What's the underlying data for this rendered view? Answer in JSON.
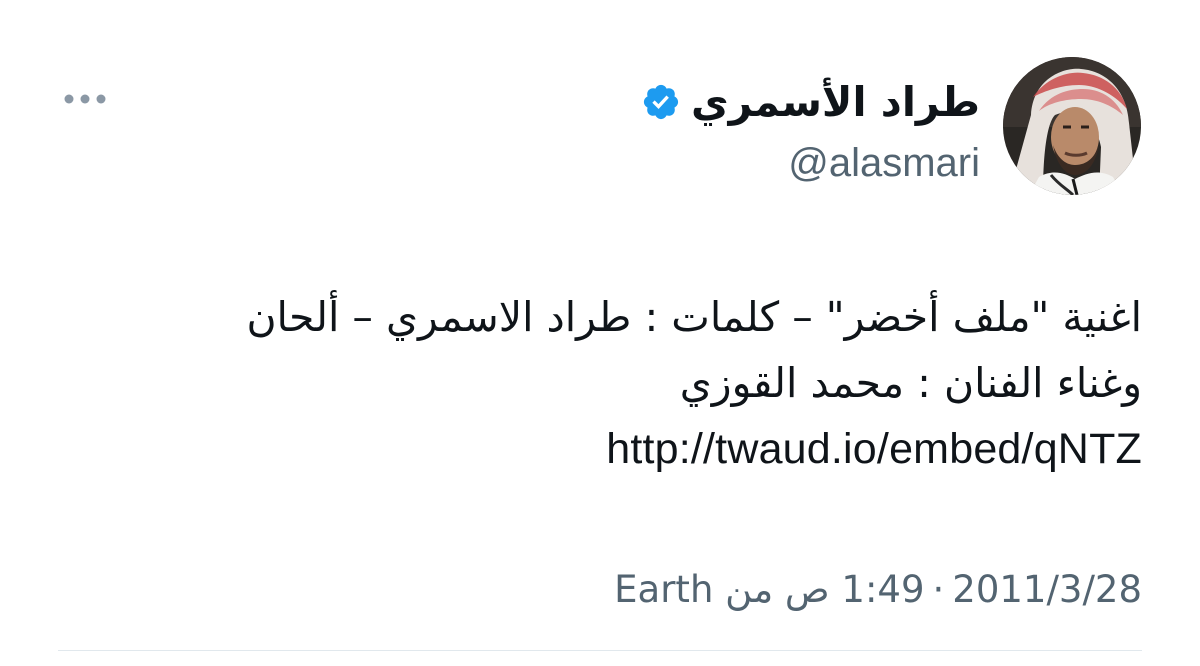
{
  "author": {
    "display_name": "طراد الأسمري",
    "handle": "@alasmari",
    "verified_color": "#1d9bf0"
  },
  "tweet": {
    "lines": [
      "اغنية \"ملف أخضر\" – كلمات : طراد الاسمري – ألحان",
      "وغناء الفنان : محمد القوزي"
    ],
    "link": "http://twaud.io/embed/qNTZ"
  },
  "meta": {
    "date": "2011/3/28",
    "separator": "·",
    "time": "1:49 ص",
    "source_prefix": "من",
    "source": "Earth"
  },
  "icons": {
    "more": "more-horizontal-icon",
    "verified": "verified-badge-icon"
  }
}
